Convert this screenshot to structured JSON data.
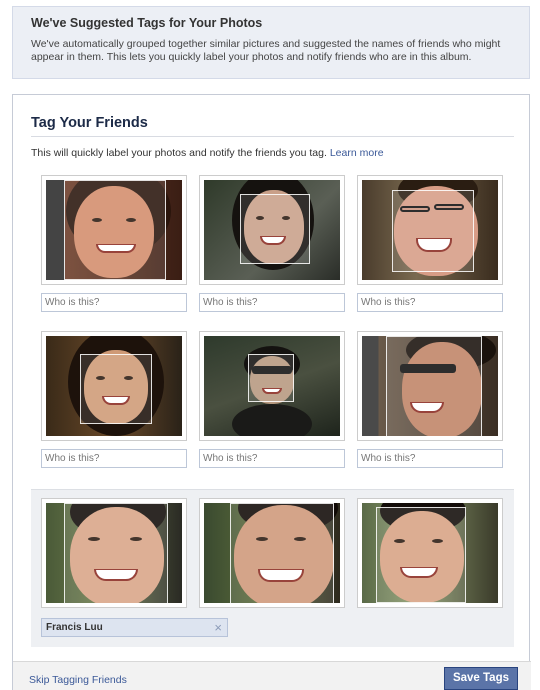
{
  "notice": {
    "title": "We've Suggested Tags for Your Photos",
    "body": "We've automatically grouped together similar pictures and suggested the names of friends who might appear in them. This lets you quickly label your photos and notify friends who are in this album."
  },
  "panel": {
    "title": "Tag Your Friends",
    "intro": "This will quickly label your photos and notify the friends you tag.",
    "learn_more": "Learn more"
  },
  "group1": {
    "placeholders": [
      "Who is this?",
      "Who is this?",
      "Who is this?"
    ]
  },
  "group2": {
    "placeholders": [
      "Who is this?",
      "Who is this?",
      "Who is this?"
    ]
  },
  "group3": {
    "tag_value": "Francis Luu",
    "remove_icon": "close-icon"
  },
  "footer": {
    "skip_label": "Skip Tagging Friends",
    "save_label": "Save Tags"
  }
}
